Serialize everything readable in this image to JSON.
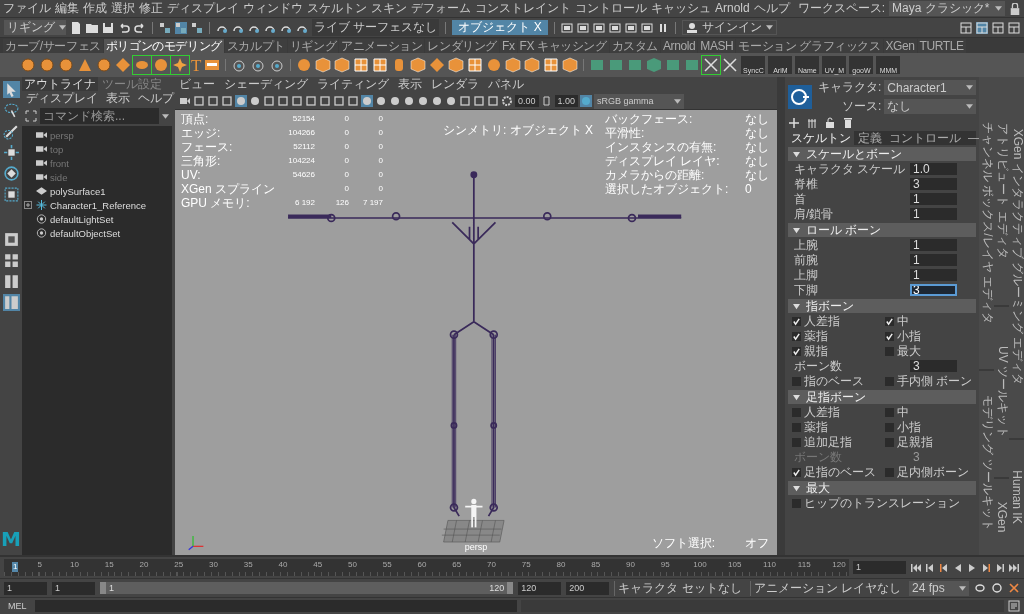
{
  "menubar": {
    "items": [
      "ファイル",
      "編集",
      "作成",
      "選択",
      "修正",
      "ディスプレイ",
      "ウィンドウ",
      "スケルトン",
      "スキン",
      "デフォーム",
      "コンストレイント",
      "コントロール",
      "キャッシュ",
      "Arnold",
      "ヘルプ"
    ],
    "workspace_label": "ワークスペース:",
    "workspace": "Maya クラシック*"
  },
  "status_line": {
    "mode": "リギング",
    "live_surface": "ライブ サーフェスなし",
    "symmetry": "オブジェクト X",
    "sign_in": "サインイン"
  },
  "shelf": {
    "tabs": [
      {
        "label": "カーブ/サーフェス",
        "selected": false
      },
      {
        "label": "ポリゴンのモデリング",
        "selected": true
      },
      {
        "label": "スカルプト",
        "selected": false
      },
      {
        "label": "リギング",
        "selected": false
      },
      {
        "label": "アニメーション",
        "selected": false
      },
      {
        "label": "レンダリング",
        "selected": false
      },
      {
        "label": "Fx",
        "selected": false
      },
      {
        "label": "FX キャッシング",
        "selected": false
      },
      {
        "label": "カスタム",
        "selected": false
      },
      {
        "label": "Arnold",
        "selected": false
      },
      {
        "label": "MASH",
        "selected": false
      },
      {
        "label": "モーション グラフィックス",
        "selected": false
      },
      {
        "label": "XGen",
        "selected": false
      },
      {
        "label": "TURTLE",
        "selected": false
      }
    ],
    "type_tool": "T",
    "labeled_buttons": [
      "SyncC",
      "AriM",
      "Name",
      "UV_M",
      "gooW",
      "MMM"
    ]
  },
  "outliner": {
    "tabs": [
      {
        "label": "アウトライナ",
        "selected": true
      },
      {
        "label": "ツール設定",
        "selected": false
      }
    ],
    "menu": [
      "ディスプレイ",
      "表示",
      "ヘルプ"
    ],
    "search_placeholder": "コマンド検索...",
    "items": [
      {
        "name": "persp",
        "kind": "camera",
        "dimmed": true,
        "expandable": false
      },
      {
        "name": "top",
        "kind": "camera",
        "dimmed": true,
        "expandable": false
      },
      {
        "name": "front",
        "kind": "camera",
        "dimmed": true,
        "expandable": false
      },
      {
        "name": "side",
        "kind": "camera",
        "dimmed": true,
        "expandable": false
      },
      {
        "name": "polySurface1",
        "kind": "mesh",
        "dimmed": false,
        "expandable": false
      },
      {
        "name": "Character1_Reference",
        "kind": "joint",
        "dimmed": false,
        "expandable": true
      },
      {
        "name": "defaultLightSet",
        "kind": "set",
        "dimmed": false,
        "expandable": false
      },
      {
        "name": "defaultObjectSet",
        "kind": "set",
        "dimmed": false,
        "expandable": false
      }
    ]
  },
  "viewport": {
    "menu": [
      "ビュー",
      "シェーディング",
      "ライティング",
      "表示",
      "レンダラ",
      "パネル"
    ],
    "exposure": "0.00",
    "gamma": "1.00",
    "color_space": "sRGB gamma",
    "stats": [
      {
        "label": "頂点:",
        "values": [
          "52154",
          "0",
          "0"
        ]
      },
      {
        "label": "エッジ:",
        "values": [
          "104266",
          "0",
          "0"
        ]
      },
      {
        "label": "フェース:",
        "values": [
          "52112",
          "0",
          "0"
        ]
      },
      {
        "label": "三角形:",
        "values": [
          "104224",
          "0",
          "0"
        ]
      },
      {
        "label": "UV:",
        "values": [
          "54626",
          "0",
          "0"
        ]
      },
      {
        "label": "XGen スプライン",
        "values": [
          "0",
          "0"
        ]
      },
      {
        "label": "GPU メモリ:",
        "values": [
          "6 192",
          "126",
          "7 197"
        ]
      }
    ],
    "symmetry_hud": "シンメトリ: オブジェクト X",
    "info": [
      {
        "label": "バックフェース:",
        "value": "なし"
      },
      {
        "label": "平滑性:",
        "value": "なし"
      },
      {
        "label": "インスタンスの有無:",
        "value": "なし"
      },
      {
        "label": "ディスプレイ レイヤ:",
        "value": "なし"
      },
      {
        "label": "カメラからの距離:",
        "value": "なし"
      },
      {
        "label": "選択したオブジェクト:",
        "value": "0"
      }
    ],
    "camera": "persp",
    "soft_select_label": "ソフト選択:",
    "soft_select": "オフ"
  },
  "attribute_panel": {
    "character_label": "キャラクタ:",
    "character": "Character1",
    "source_label": "ソース:",
    "source": "なし",
    "tabs": [
      {
        "label": "スケルトン",
        "selected": true
      },
      {
        "label": "定義",
        "selected": false
      },
      {
        "label": "コントロール",
        "selected": false
      },
      {
        "label": "—",
        "selected": false
      }
    ],
    "sections": [
      {
        "title": "スケールとボーン",
        "expanded": true,
        "rows": [
          {
            "kind": "field",
            "label": "キャラクタ スケール",
            "value": "1.0",
            "focused": false,
            "disabled": false
          },
          {
            "kind": "field",
            "label": "脊椎",
            "value": "3",
            "focused": false,
            "disabled": false
          },
          {
            "kind": "field",
            "label": "首",
            "value": "1",
            "focused": false,
            "disabled": false
          },
          {
            "kind": "field",
            "label": "肩/鎖骨",
            "value": "1",
            "focused": false,
            "disabled": false
          }
        ]
      },
      {
        "title": "ロール ボーン",
        "expanded": true,
        "rows": [
          {
            "kind": "field",
            "label": "上腕",
            "value": "1",
            "focused": false,
            "disabled": false
          },
          {
            "kind": "field",
            "label": "前腕",
            "value": "1",
            "focused": false,
            "disabled": false
          },
          {
            "kind": "field",
            "label": "上脚",
            "value": "1",
            "focused": false,
            "disabled": false
          },
          {
            "kind": "field",
            "label": "下脚",
            "value": "3",
            "focused": true,
            "disabled": false
          }
        ]
      },
      {
        "title": "指ボーン",
        "expanded": true,
        "rows": [
          {
            "kind": "checks",
            "items": [
              {
                "label": "人差指",
                "checked": true
              },
              {
                "label": "中",
                "checked": true
              },
              {
                "label": "薬指",
                "checked": true
              },
              {
                "label": "小指",
                "checked": true
              },
              {
                "label": "親指",
                "checked": true
              },
              {
                "label": "最大",
                "checked": false
              }
            ]
          },
          {
            "kind": "field",
            "label": "ボーン数",
            "value": "3",
            "focused": false,
            "disabled": false
          },
          {
            "kind": "checks",
            "items": [
              {
                "label": "指のベース",
                "checked": false
              },
              {
                "label": "手内側 ボーン",
                "checked": false
              }
            ]
          }
        ]
      },
      {
        "title": "足指ボーン",
        "expanded": true,
        "rows": [
          {
            "kind": "checks",
            "items": [
              {
                "label": "人差指",
                "checked": false
              },
              {
                "label": "中",
                "checked": false
              },
              {
                "label": "薬指",
                "checked": false
              },
              {
                "label": "小指",
                "checked": false
              },
              {
                "label": "追加足指",
                "checked": false
              },
              {
                "label": "足親指",
                "checked": false
              }
            ]
          },
          {
            "kind": "field",
            "label": "ボーン数",
            "value": "3",
            "focused": false,
            "disabled": true
          },
          {
            "kind": "checks",
            "items": [
              {
                "label": "足指のベース",
                "checked": true
              },
              {
                "label": "足内側ボーン",
                "checked": false
              }
            ]
          }
        ]
      },
      {
        "title": "最大",
        "expanded": true,
        "rows": [
          {
            "kind": "checks",
            "items": [
              {
                "label": "ヒップのトランスレーション",
                "checked": false
              }
            ]
          }
        ]
      }
    ]
  },
  "side_tabs": [
    "チャンネル ボックス/レイヤ エディタ",
    "モデリング ツールキット",
    "アトリビュート エディタ",
    "UV ツールキット",
    "XGen",
    "XGen インタラクティブ グルーミング エディタ",
    "Human IK"
  ],
  "logo": "M",
  "timeline": {
    "current_marker": "1",
    "ruler_labels": [
      "5",
      "10",
      "15",
      "20",
      "25",
      "30",
      "35",
      "40",
      "45",
      "50",
      "55",
      "60",
      "65",
      "70",
      "75",
      "80",
      "85",
      "90",
      "95",
      "100",
      "105",
      "110",
      "115",
      "120"
    ],
    "current_frame": "1"
  },
  "range": {
    "level": 1,
    "start": "1",
    "playback_start": "1",
    "slider_start": "1",
    "slider_end": "120",
    "playback_end": "120",
    "end": "200",
    "character_set": "キャラクタ セットなし",
    "anim_layer": "アニメーション レイヤなし",
    "fps": "24 fps"
  },
  "command_line": {
    "language": "MEL"
  }
}
